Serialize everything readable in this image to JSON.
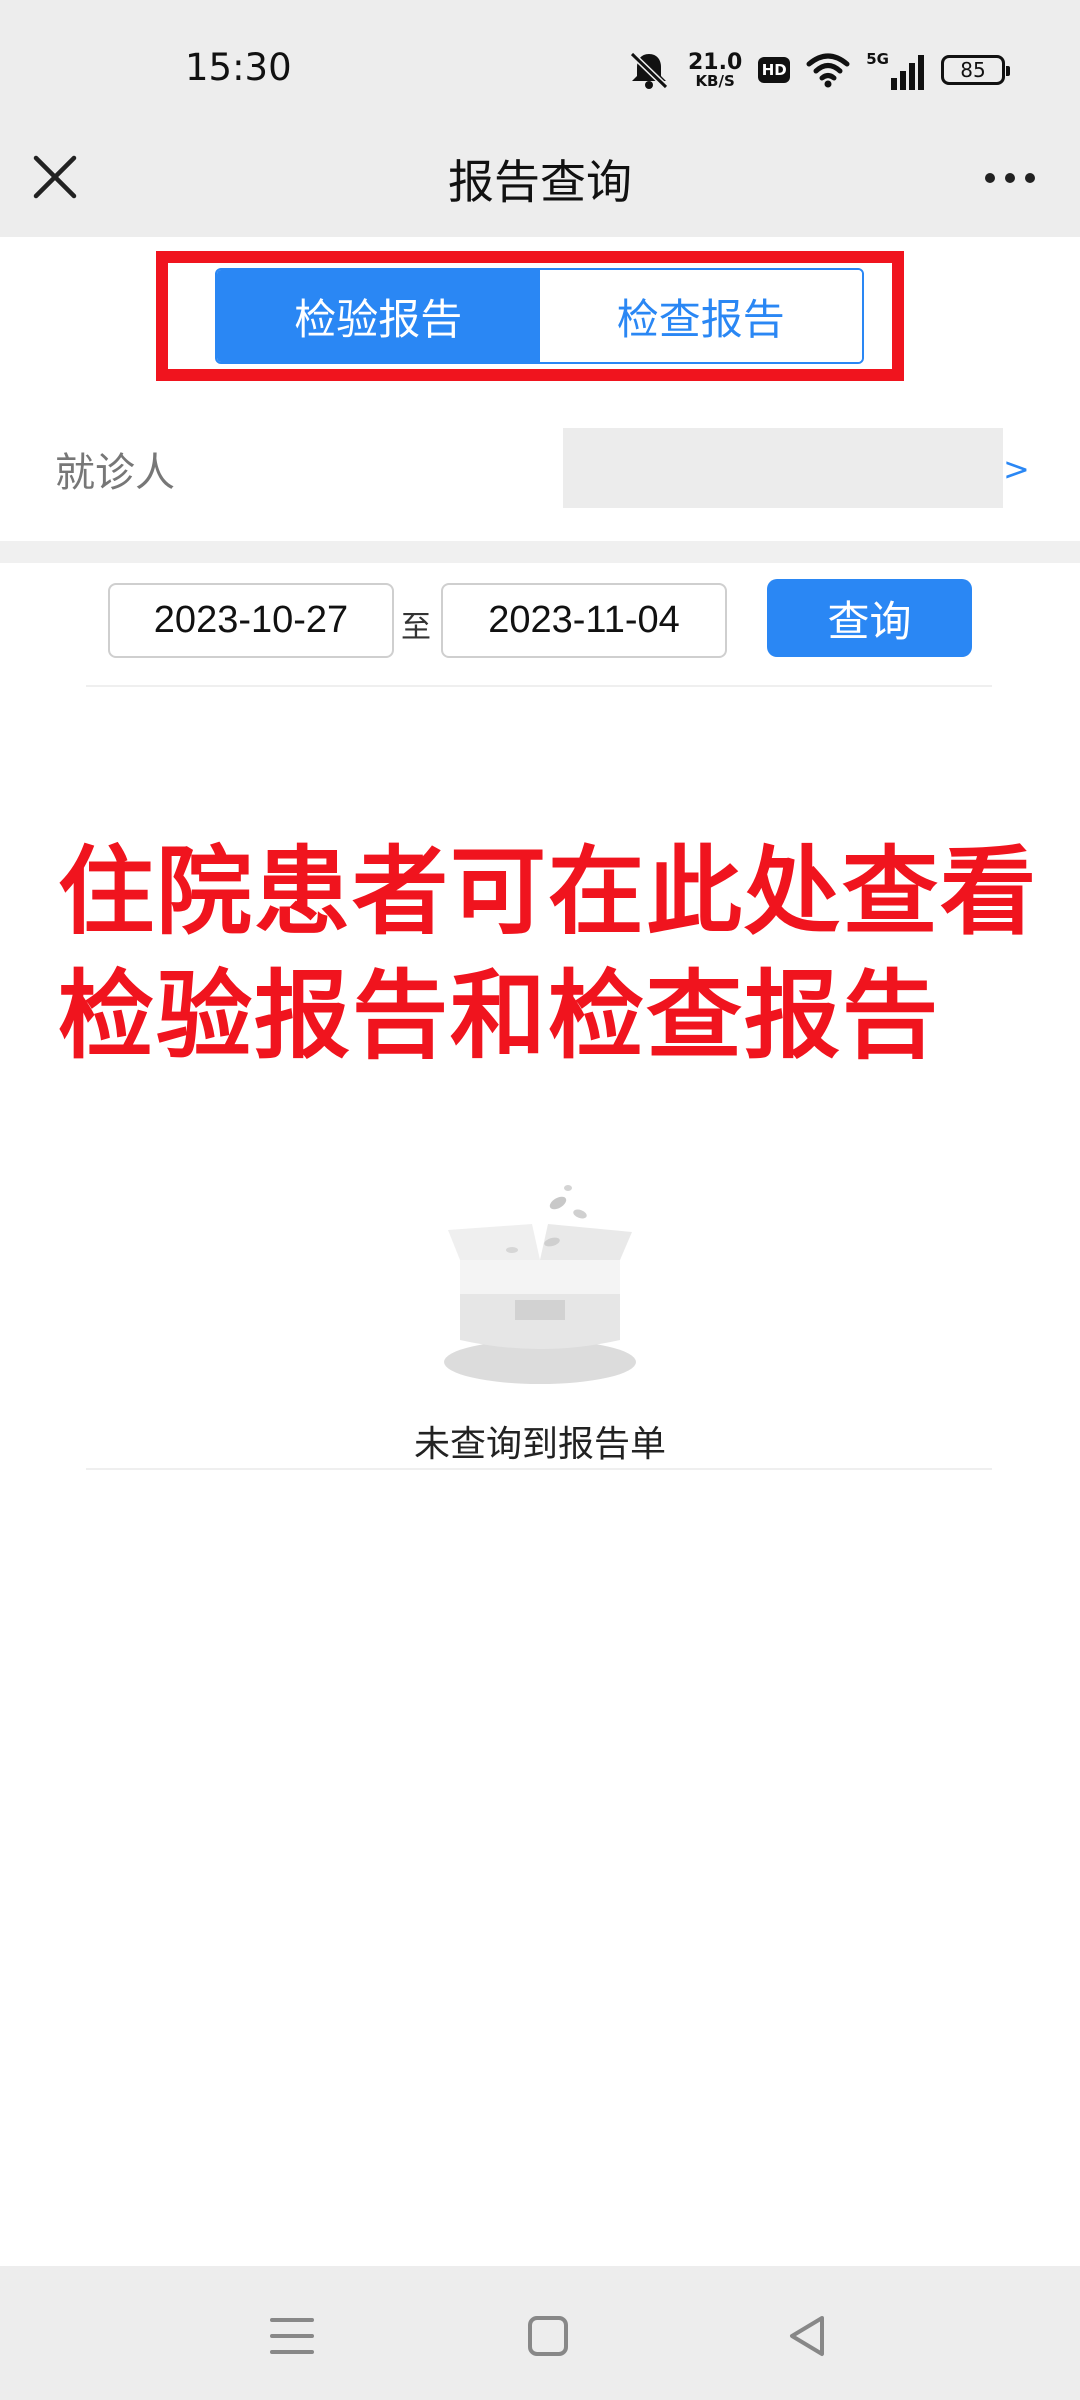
{
  "status_bar": {
    "time": "15:30",
    "net_speed_value": "21.0",
    "net_speed_unit": "KB/S",
    "hd_label": "HD",
    "network_label": "5G",
    "battery_level": "85",
    "icons": [
      "bell-muted-icon",
      "wifi-icon",
      "signal-icon",
      "battery-icon"
    ]
  },
  "header": {
    "title": "报告查询",
    "close_icon": "close-icon",
    "more_icon": "more-icon"
  },
  "tabs": {
    "items": [
      {
        "label": "检验报告",
        "active": true
      },
      {
        "label": "检查报告",
        "active": false
      }
    ],
    "highlight_color": "#f0141e"
  },
  "patient": {
    "label": "就诊人",
    "value": "",
    "arrow": ">"
  },
  "query": {
    "start_date": "2023-10-27",
    "separator": "至",
    "end_date": "2023-11-04",
    "button_label": "查询"
  },
  "annotation": {
    "line1": "住院患者可在此处查看",
    "line2": "检验报告和检查报告"
  },
  "empty_state": {
    "icon": "empty-box-icon",
    "text": "未查询到报告单"
  },
  "nav_bar": {
    "icons": [
      "menu-icon",
      "home-icon",
      "back-icon"
    ]
  },
  "colors": {
    "accent": "#2a87f4",
    "annotation_red": "#f0141e",
    "bar_background": "#ededed"
  }
}
